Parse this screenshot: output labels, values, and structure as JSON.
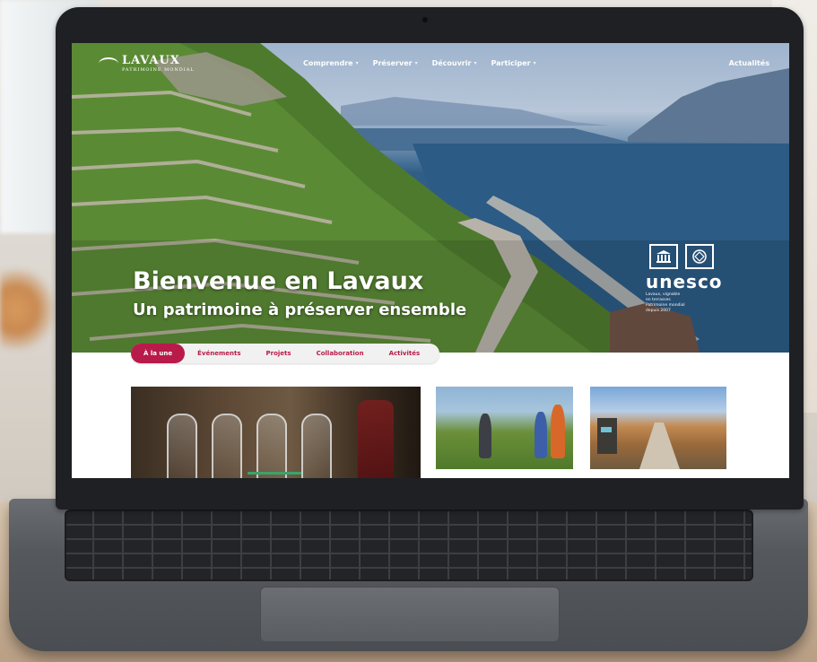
{
  "site": {
    "logo_text": "LAVAUX",
    "logo_subtext": "PATRIMOINE MONDIAL",
    "nav": [
      {
        "label": "Comprendre"
      },
      {
        "label": "Préserver"
      },
      {
        "label": "Découvrir"
      },
      {
        "label": "Participer"
      }
    ],
    "nav_right": "Actualités",
    "hero_title": "Bienvenue en Lavaux",
    "hero_subtitle": "Un patrimoine à préserver ensemble",
    "unesco": {
      "word": "unesco",
      "caption_lines": [
        "Lavaux, vignoble",
        "en terrasses",
        "Patrimoine mondial",
        "depuis 2007"
      ]
    },
    "tabs": [
      {
        "label": "À la une",
        "active": true
      },
      {
        "label": "Événements",
        "active": false
      },
      {
        "label": "Projets",
        "active": false
      },
      {
        "label": "Collaboration",
        "active": false
      },
      {
        "label": "Activités",
        "active": false
      }
    ]
  },
  "colors": {
    "accent": "#b81b4a",
    "lake": "#2b5a83",
    "vineyard": "#4e7a2e",
    "bezel": "#1e2023"
  },
  "icons": [
    "unesco-temple-icon",
    "world-heritage-emblem-icon",
    "chevron-down-icon"
  ]
}
